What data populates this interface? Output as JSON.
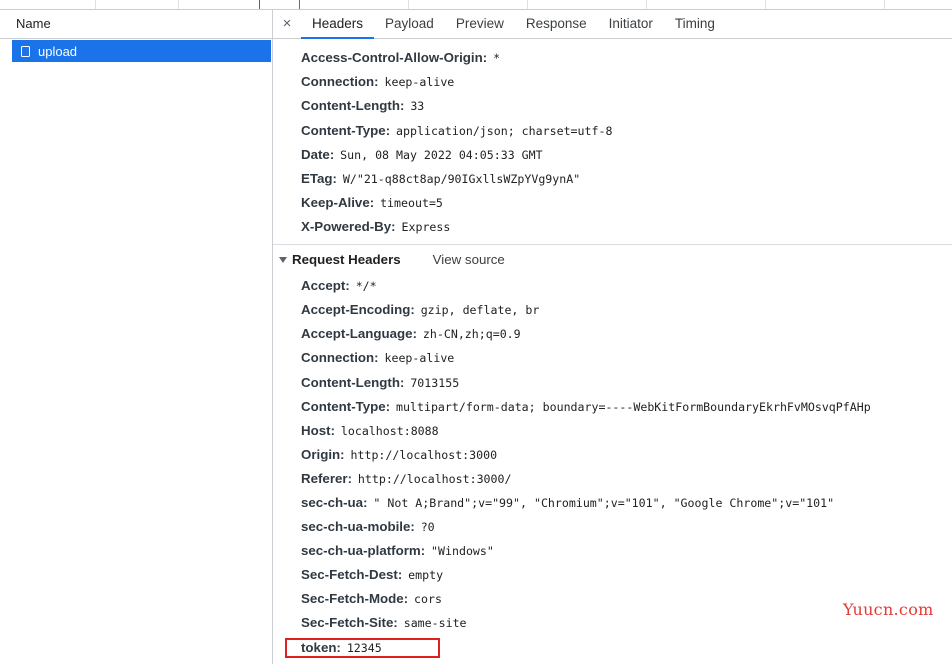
{
  "request_list": {
    "header": "Name",
    "items": [
      {
        "name": "upload",
        "selected": true,
        "icon": "document-icon"
      }
    ]
  },
  "tabs": {
    "close_glyph": "×",
    "items": [
      "Headers",
      "Payload",
      "Preview",
      "Response",
      "Initiator",
      "Timing"
    ],
    "active": "Headers"
  },
  "response_headers": [
    {
      "name": "Access-Control-Allow-Origin",
      "value": "*"
    },
    {
      "name": "Connection",
      "value": "keep-alive"
    },
    {
      "name": "Content-Length",
      "value": "33"
    },
    {
      "name": "Content-Type",
      "value": "application/json; charset=utf-8"
    },
    {
      "name": "Date",
      "value": "Sun, 08 May 2022 04:05:33 GMT"
    },
    {
      "name": "ETag",
      "value": "W/\"21-q88ct8ap/90IGxllsWZpYVg9ynA\""
    },
    {
      "name": "Keep-Alive",
      "value": "timeout=5"
    },
    {
      "name": "X-Powered-By",
      "value": "Express"
    }
  ],
  "request_section": {
    "title": "Request Headers",
    "view_source": "View source"
  },
  "request_headers": [
    {
      "name": "Accept",
      "value": "*/*"
    },
    {
      "name": "Accept-Encoding",
      "value": "gzip, deflate, br"
    },
    {
      "name": "Accept-Language",
      "value": "zh-CN,zh;q=0.9"
    },
    {
      "name": "Connection",
      "value": "keep-alive"
    },
    {
      "name": "Content-Length",
      "value": "7013155"
    },
    {
      "name": "Content-Type",
      "value": "multipart/form-data; boundary=----WebKitFormBoundaryEkrhFvMOsvqPfAHp"
    },
    {
      "name": "Host",
      "value": "localhost:8088"
    },
    {
      "name": "Origin",
      "value": "http://localhost:3000"
    },
    {
      "name": "Referer",
      "value": "http://localhost:3000/"
    },
    {
      "name": "sec-ch-ua",
      "value": "\" Not A;Brand\";v=\"99\", \"Chromium\";v=\"101\", \"Google Chrome\";v=\"101\""
    },
    {
      "name": "sec-ch-ua-mobile",
      "value": "?0"
    },
    {
      "name": "sec-ch-ua-platform",
      "value": "\"Windows\""
    },
    {
      "name": "Sec-Fetch-Dest",
      "value": "empty"
    },
    {
      "name": "Sec-Fetch-Mode",
      "value": "cors"
    },
    {
      "name": "Sec-Fetch-Site",
      "value": "same-site"
    },
    {
      "name": "token",
      "value": "12345",
      "highlighted": true
    }
  ],
  "watermark": "Yuucn.com",
  "colors": {
    "selection": "#1a73e8",
    "highlight_box": "#e02020",
    "watermark": "#e53935"
  }
}
